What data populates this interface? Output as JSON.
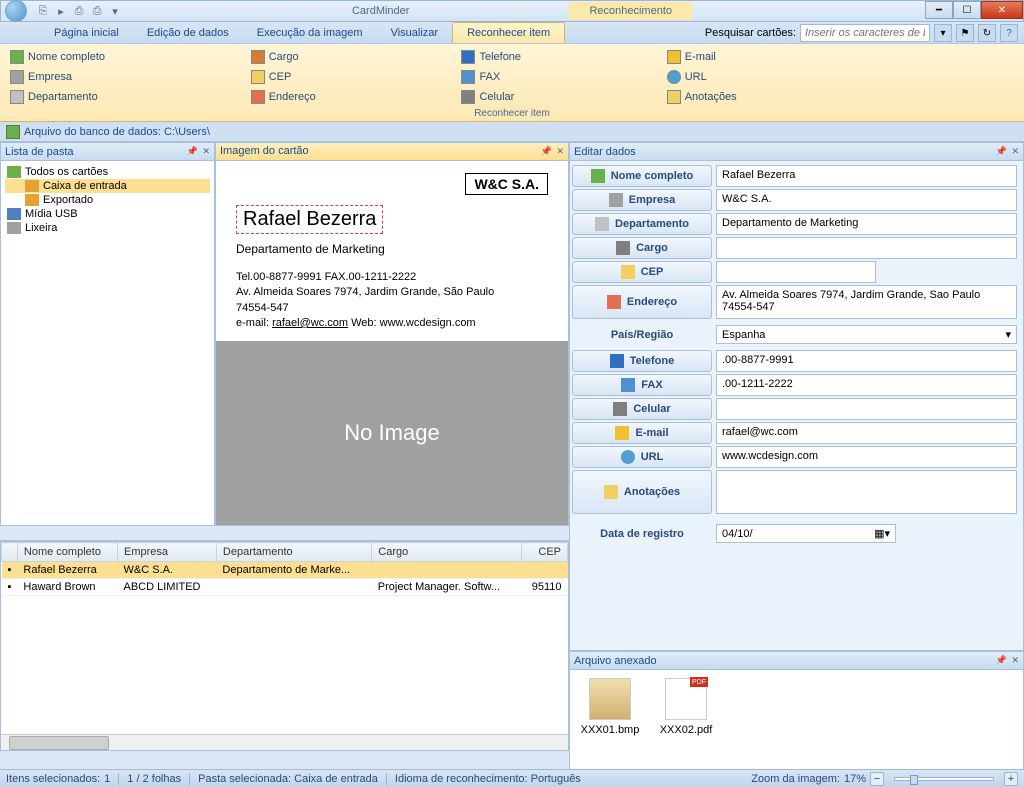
{
  "app_title": "CardMinder",
  "context_tab": "Reconhecimento",
  "ribbon_tabs": {
    "home": "Página inicial",
    "edit": "Edição de dados",
    "image": "Execução da imagem",
    "view": "Visualizar",
    "recognize": "Reconhecer item"
  },
  "search": {
    "label": "Pesquisar cartões:",
    "placeholder": "Inserir os caracteres de busca"
  },
  "ribbon_items": {
    "nome": "Nome completo",
    "cargo": "Cargo",
    "telefone": "Telefone",
    "email": "E-mail",
    "empresa": "Empresa",
    "cep": "CEP",
    "fax": "FAX",
    "url": "URL",
    "departamento": "Departamento",
    "endereco": "Endereço",
    "celular": "Celular",
    "anotacoes": "Anotações",
    "group_caption": "Reconhecer item"
  },
  "pathbar": "Arquivo do banco de dados: C:\\Users\\",
  "panels": {
    "folders": "Lista de pasta",
    "card_image": "Imagem do cartão",
    "edit_data": "Editar dados",
    "attached": "Arquivo anexado"
  },
  "tree": {
    "all": "Todos os cartões",
    "inbox": "Caixa de entrada",
    "exported": "Exportado",
    "usb": "Mídia USB",
    "trash": "Lixeira"
  },
  "card": {
    "company_box": "W&C S.A.",
    "name": "Rafael Bezerra",
    "dept": "Departamento de Marketing",
    "tel_line": "Tel.00-8877-9991    FAX.00-1211-2222",
    "addr1": "Av. Almeida Soares 7974, Jardim Grande, São Paulo",
    "addr2": "74554-547",
    "email_line": "e-mail: rafael@wc.com     Web: www.wcdesign.com",
    "no_image": "No Image"
  },
  "table": {
    "headers": {
      "name": "Nome completo",
      "company": "Empresa",
      "dept": "Departamento",
      "title": "Cargo",
      "zip": "CEP"
    },
    "rows": [
      {
        "name": "Rafael Bezerra",
        "company": "W&C S.A.",
        "dept": "Departamento de Marke...",
        "title": "",
        "zip": ""
      },
      {
        "name": "Haward Brown",
        "company": "ABCD LIMITED",
        "dept": "",
        "title": "Project Manager. Softw...",
        "zip": "95110"
      }
    ]
  },
  "form": {
    "full_name": {
      "label": "Nome completo",
      "value": "Rafael Bezerra"
    },
    "company": {
      "label": "Empresa",
      "value": "W&C S.A."
    },
    "department": {
      "label": "Departamento",
      "value": "Departamento de Marketing"
    },
    "title": {
      "label": "Cargo",
      "value": ""
    },
    "zip": {
      "label": "CEP",
      "value": ""
    },
    "address": {
      "label": "Endereço",
      "value": "Av. Almeida Soares 7974, Jardim Grande, Sao Paulo 74554-547"
    },
    "country": {
      "label": "País/Região",
      "value": "Espanha"
    },
    "phone": {
      "label": "Telefone",
      "value": ".00-8877-9991"
    },
    "fax": {
      "label": "FAX",
      "value": ".00-1211-2222"
    },
    "mobile": {
      "label": "Celular",
      "value": ""
    },
    "email": {
      "label": "E-mail",
      "value": "rafael@wc.com"
    },
    "url": {
      "label": "URL",
      "value": "www.wcdesign.com"
    },
    "notes": {
      "label": "Anotações",
      "value": ""
    },
    "reg_date": {
      "label": "Data de registro",
      "value": "04/10/"
    }
  },
  "attachments": [
    {
      "name": "XXX01.bmp",
      "type": "bmp"
    },
    {
      "name": "XXX02.pdf",
      "type": "pdf"
    }
  ],
  "statusbar": {
    "selected_label": "Itens selecionados:",
    "selected_count": "1",
    "sheets": "1 / 2 folhas",
    "folder": "Pasta selecionada: Caixa de entrada",
    "lang": "Idioma de reconhecimento: Português",
    "zoom_label": "Zoom da imagem:",
    "zoom_value": "17%"
  }
}
